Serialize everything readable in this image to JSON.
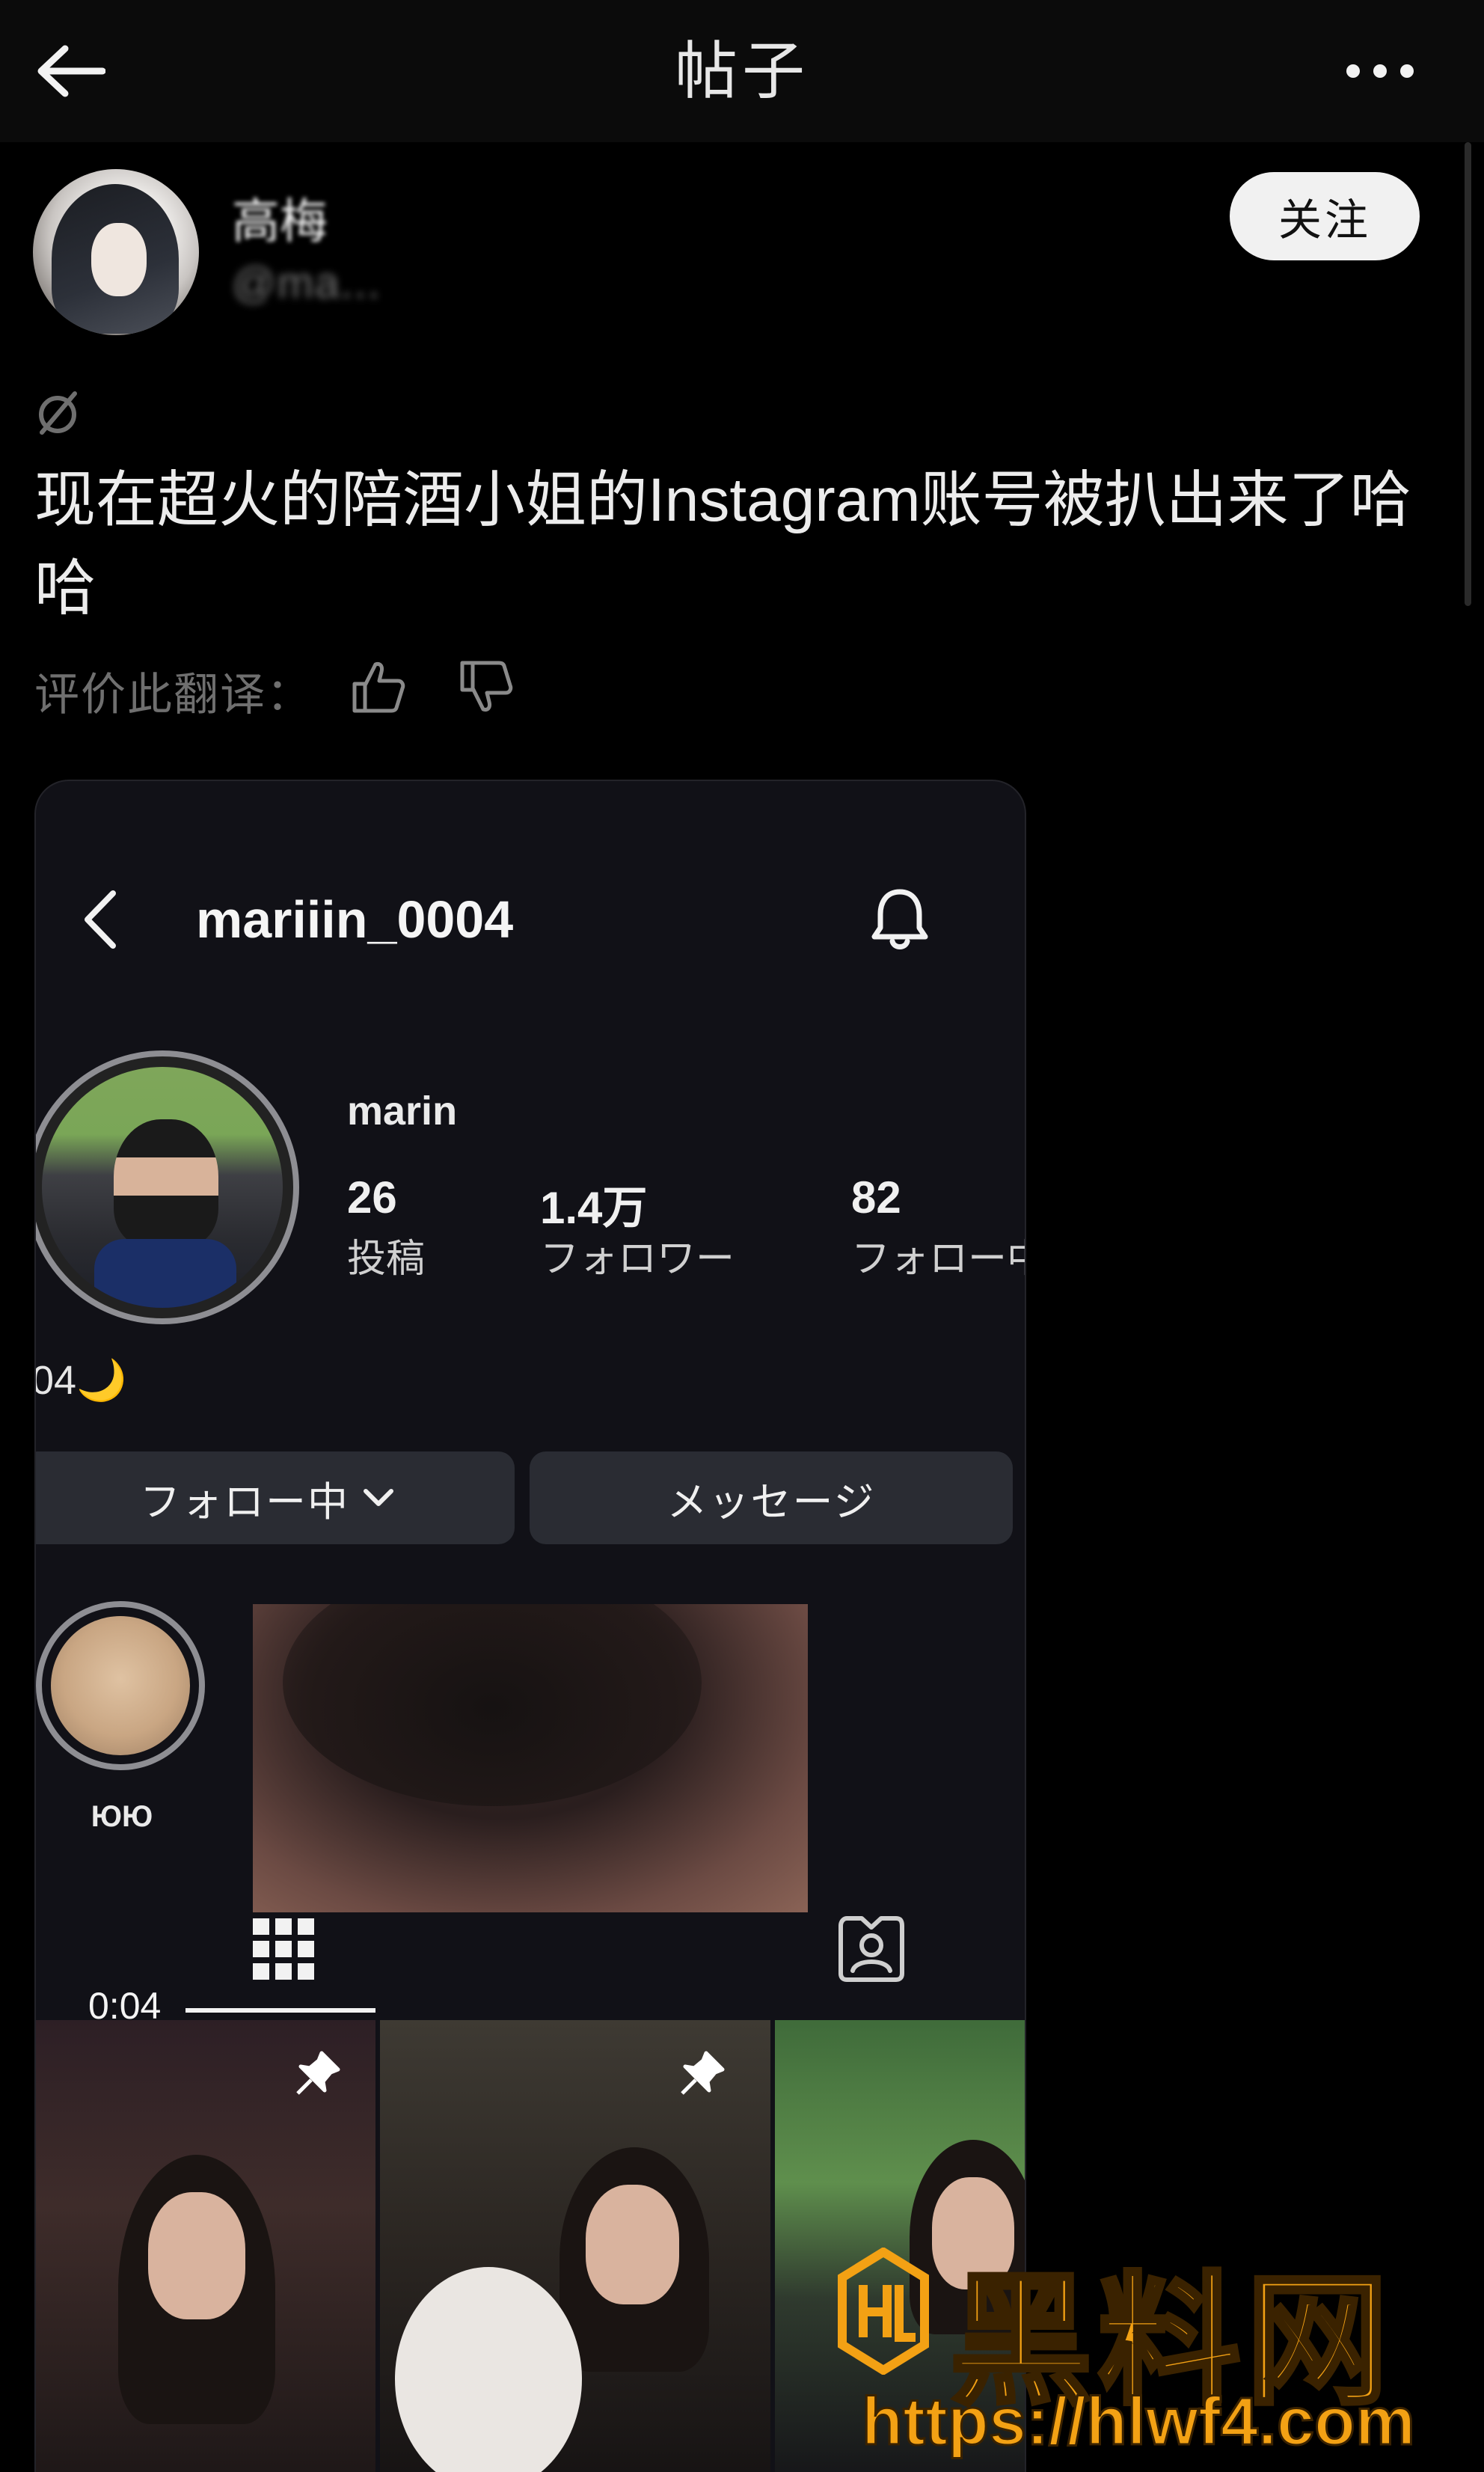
{
  "header": {
    "title": "帖子",
    "back_icon": "arrow-left-icon",
    "more_icon": "more-horizontal-icon"
  },
  "post": {
    "author_name": "高梅",
    "author_handle": "@ma...",
    "follow_label": "关注",
    "text": "现在超火的陪酒小姐的Instagram账号被扒出来了哈哈",
    "rate_translation_label": "评价此翻译："
  },
  "embedded": {
    "username": "mariiin_0004",
    "display_name": "marin",
    "stats": {
      "posts_count": "26",
      "posts_label": "投稿",
      "followers_count": "1.4万",
      "followers_label": "フォロワー",
      "following_count": "82",
      "following_label": "フォロー中"
    },
    "bio": "04🌙",
    "following_button": "フォロー中",
    "message_button": "メッセージ",
    "highlight_label": "ЮЮ",
    "video_duration": "0:04"
  },
  "watermark": {
    "brand": "黑料网",
    "url": "https://hlwf4.com"
  },
  "colors": {
    "background": "#000000",
    "card": "#111117",
    "watermark": "#f3a114"
  }
}
